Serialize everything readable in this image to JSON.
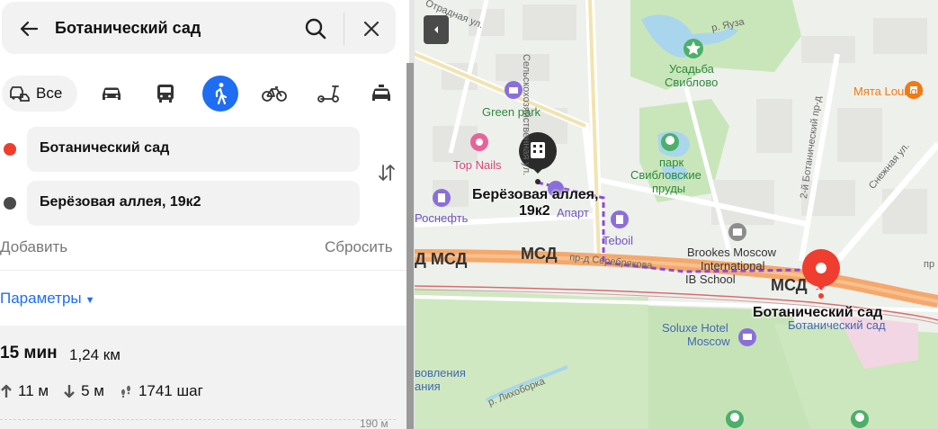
{
  "search": {
    "query": "Ботанический сад"
  },
  "modes": {
    "all_label": "Все",
    "active": "pedestrian"
  },
  "route": {
    "from": "Ботанический сад",
    "to": "Берёзовая аллея, 19к2",
    "from_color": "#ef3d2f",
    "to_color": "#4a4a4a",
    "add_label": "Добавить",
    "reset_label": "Сбросить",
    "params_label": "Параметры"
  },
  "result": {
    "time": "15 мин",
    "distance": "1,24 км",
    "ascent": "11 м",
    "descent": "5 м",
    "steps": "1741 шаг",
    "elevation_max": "190 м"
  },
  "map": {
    "labels": {
      "green_park": "Green park",
      "top_nails": "Top Nails",
      "rosneft": "Роснефть",
      "apart": "Апарт",
      "teboil": "Teboil",
      "usadba_1": "Усадьба",
      "usadba_2": "Свиблово",
      "park_1": "парк",
      "park_2": "Свибловские",
      "park_3": "пруды",
      "myata": "Мята Lounge",
      "brookes_1": "Brookes Moscow",
      "brookes_2": "International",
      "brookes_3": "IB School",
      "soluxe_1": "Soluxe Hotel",
      "soluxe_2": "Moscow",
      "station": "Ботанический сад",
      "vovleniya_1": "вовления",
      "vovleniya_2": "ания"
    },
    "streets": {
      "otradnaya": "Отрадная ул.",
      "selskokhoz": "Сельскохозяйственная ул.",
      "yauza": "р. Яуза",
      "botanich_proezd": "2-й Ботанический пр-д",
      "snezhnaya": "Снежная ул.",
      "serebryakova": "пр-д Серебрякова",
      "likhoborka": "р. Лихоборка",
      "pr_right": "пр"
    },
    "msd": {
      "label_left": "Д МСД",
      "label_mid": "МСД",
      "label_right": "МСД"
    },
    "markers": {
      "start_line1": "Берёзовая аллея,",
      "start_line2": "19к2",
      "end": "Ботанический сад"
    },
    "colors": {
      "route": "#8a4bd8",
      "road_main": "#f5a86b",
      "park": "#c5e3b6",
      "water": "#9fd0e8",
      "marker_end": "#ef3d2f"
    }
  }
}
